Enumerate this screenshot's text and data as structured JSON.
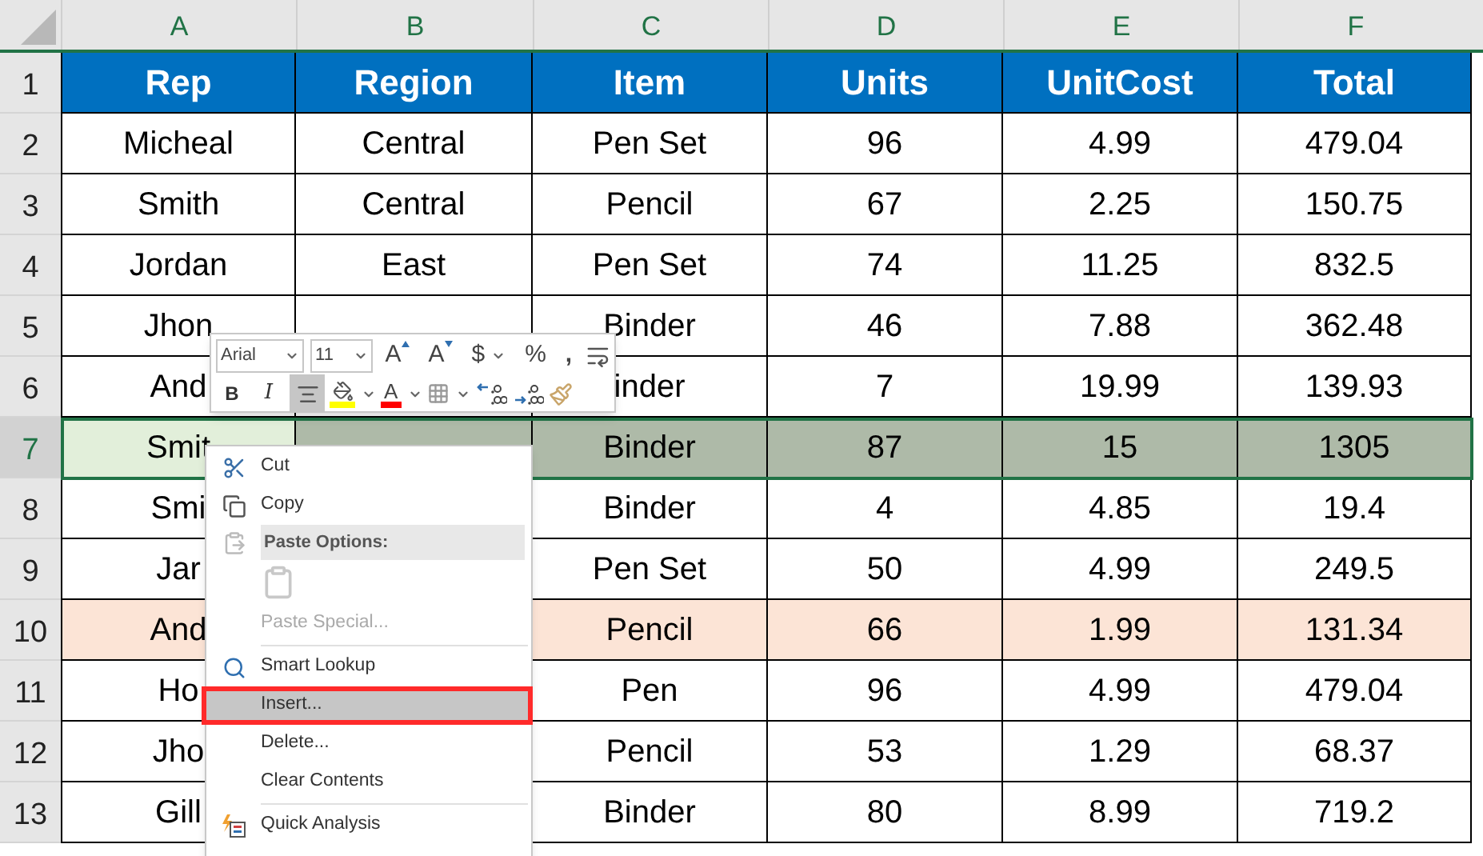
{
  "columns": [
    "A",
    "B",
    "C",
    "D",
    "E",
    "F"
  ],
  "rows": [
    {
      "number": "1",
      "selected": false,
      "header": true,
      "cells": [
        "Rep",
        "Region",
        "Item",
        "Units",
        "UnitCost",
        "Total"
      ]
    },
    {
      "number": "2",
      "selected": false,
      "cells": [
        "Micheal",
        "Central",
        "Pen Set",
        "96",
        "4.99",
        "479.04"
      ]
    },
    {
      "number": "3",
      "selected": false,
      "cells": [
        "Smith",
        "Central",
        "Pencil",
        "67",
        "2.25",
        "150.75"
      ]
    },
    {
      "number": "4",
      "selected": false,
      "cells": [
        "Jordan",
        "East",
        "Pen Set",
        "74",
        "11.25",
        "832.5"
      ]
    },
    {
      "number": "5",
      "selected": false,
      "cells": [
        "Jhon",
        "",
        "Binder",
        "46",
        "7.88",
        "362.48"
      ]
    },
    {
      "number": "6",
      "selected": false,
      "cells": [
        "And",
        "",
        "inder",
        "7",
        "19.99",
        "139.93"
      ]
    },
    {
      "number": "7",
      "selected": true,
      "cells": [
        "Smit",
        "",
        "Binder",
        "87",
        "15",
        "1305"
      ]
    },
    {
      "number": "8",
      "selected": false,
      "cells": [
        "Smi",
        "",
        "Binder",
        "4",
        "4.85",
        "19.4"
      ]
    },
    {
      "number": "9",
      "selected": false,
      "cells": [
        "Jar",
        "",
        "Pen Set",
        "50",
        "4.99",
        "249.5"
      ]
    },
    {
      "number": "10",
      "selected": false,
      "color": "#fce4d6",
      "cells": [
        "And",
        "",
        "Pencil",
        "66",
        "1.99",
        "131.34"
      ]
    },
    {
      "number": "11",
      "selected": false,
      "cells": [
        "Ho",
        "",
        "Pen",
        "96",
        "4.99",
        "479.04"
      ]
    },
    {
      "number": "12",
      "selected": false,
      "cells": [
        "Jho",
        "",
        "Pencil",
        "53",
        "1.29",
        "68.37"
      ]
    },
    {
      "number": "13",
      "selected": false,
      "cells": [
        "Gill",
        "",
        "Binder",
        "80",
        "8.99",
        "719.2"
      ]
    }
  ],
  "mini_toolbar": {
    "font": "Arial",
    "size": "11",
    "row1": [
      {
        "kind": "grow",
        "label": "A"
      },
      {
        "kind": "shrink",
        "label": "A"
      },
      {
        "kind": "currency",
        "label": "$"
      },
      {
        "kind": "percent",
        "label": "%"
      },
      {
        "kind": "comma",
        "label": ","
      },
      {
        "kind": "wrap"
      }
    ],
    "row2": [
      {
        "kind": "bold",
        "label": "B",
        "selected": false
      },
      {
        "kind": "italic",
        "label": "I",
        "selected": false
      },
      {
        "kind": "align",
        "selected": true
      },
      {
        "kind": "fill",
        "selected": false
      },
      {
        "kind": "fontcolor",
        "label": "A",
        "selected": false
      },
      {
        "kind": "borders",
        "selected": false
      },
      {
        "kind": "increase",
        "selected": false
      },
      {
        "kind": "decrease",
        "selected": false
      },
      {
        "kind": "painter",
        "selected": false
      }
    ]
  },
  "context_menu": [
    {
      "kind": "cut",
      "label": "Cut",
      "disabled": false,
      "selected": false
    },
    {
      "kind": "copy",
      "label": "Copy",
      "disabled": false,
      "selected": false
    },
    {
      "kind": "header",
      "label": "Paste Options:"
    },
    {
      "kind": "paste"
    },
    {
      "kind": "plain",
      "label": "Paste Special...",
      "disabled": true,
      "selected": false
    },
    {
      "kind": "separator"
    },
    {
      "kind": "lookup",
      "label": "Smart Lookup",
      "disabled": false,
      "selected": false
    },
    {
      "kind": "plain",
      "label": "Insert...",
      "disabled": false,
      "selected": true
    },
    {
      "kind": "plain",
      "label": "Delete...",
      "disabled": false,
      "selected": false
    },
    {
      "kind": "plain",
      "label": "Clear Contents",
      "disabled": false,
      "selected": false
    },
    {
      "kind": "separator"
    },
    {
      "kind": "analysis",
      "label": "Quick Analysis",
      "disabled": false,
      "selected": false
    }
  ]
}
